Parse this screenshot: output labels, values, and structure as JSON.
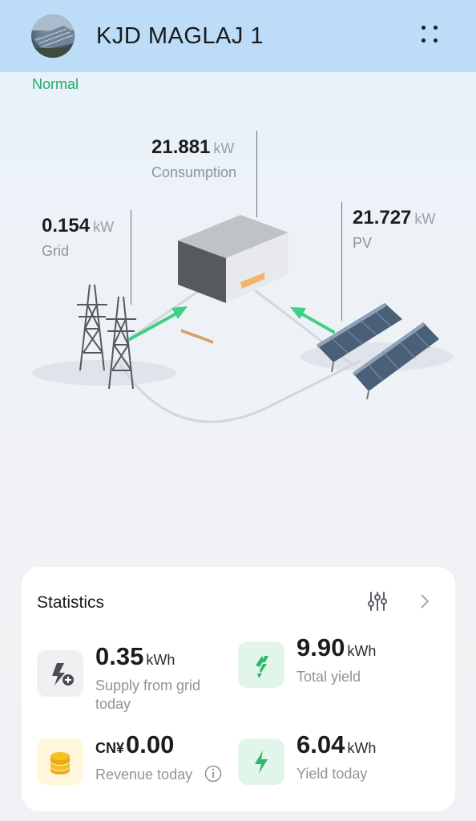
{
  "header": {
    "site_name": "KJD MAGLAJ 1",
    "avatar_icon": "site-photo",
    "menu_icon": "more-dots-icon",
    "background": "#bcdcf7"
  },
  "status": {
    "label": "Normal",
    "color": "#25a868"
  },
  "flow": {
    "consumption": {
      "value": "21.881",
      "unit": "kW",
      "label": "Consumption"
    },
    "grid": {
      "value": "0.154",
      "unit": "kW",
      "label": "Grid"
    },
    "pv": {
      "value": "21.727",
      "unit": "kW",
      "label": "PV"
    },
    "arrow_color": "#3fcf87"
  },
  "statistics": {
    "title": "Statistics",
    "filter_icon": "sliders-icon",
    "more_icon": "chevron-right-icon",
    "items": [
      {
        "value": "0.35",
        "unit": "kWh",
        "label_line1": "Supply from grid",
        "label_line2": "today",
        "icon": "grid-supply-icon"
      },
      {
        "value": "9.90",
        "unit": "kWh",
        "label_line1": "Total yield",
        "icon": "yield-total-icon"
      },
      {
        "currency": "CN¥",
        "value": "0.00",
        "label_line1": "Revenue today",
        "icon": "coins-icon",
        "info_icon": "info-icon"
      },
      {
        "value": "6.04",
        "unit": "kWh",
        "label_line1": "Yield today",
        "icon": "lightning-icon"
      }
    ]
  }
}
